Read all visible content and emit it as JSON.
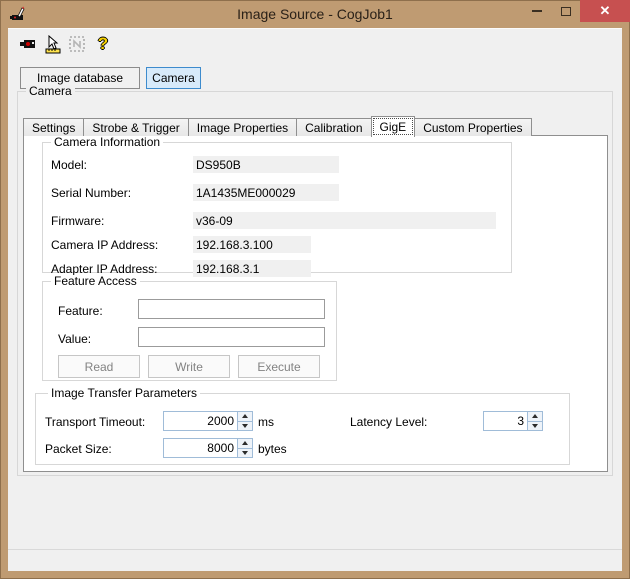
{
  "window": {
    "title": "Image Source - CogJob1",
    "close_glyph": "✕"
  },
  "colors": {
    "titlebar_tan": "#bf9b72",
    "close_red": "#c75050",
    "dialog_bg": "#f0f0f0",
    "page_bg": "#ffffff",
    "selected_button_bg": "#d7eafa",
    "selected_button_border": "#3d8bcd",
    "readonly_field_bg": "#f0f0f0"
  },
  "toolbar": {
    "help_glyph": "?"
  },
  "source_buttons": [
    {
      "label": "Image database",
      "selected": false
    },
    {
      "label": "Camera",
      "selected": true
    }
  ],
  "camera_group_label": "Camera",
  "tabs": [
    {
      "label": "Settings",
      "selected": false
    },
    {
      "label": "Strobe & Trigger",
      "selected": false
    },
    {
      "label": "Image Properties",
      "selected": false
    },
    {
      "label": "Calibration",
      "selected": false
    },
    {
      "label": "GigE",
      "selected": true
    },
    {
      "label": "Custom Properties",
      "selected": false
    }
  ],
  "camera_information": {
    "label": "Camera Information",
    "fields": [
      {
        "label": "Model:",
        "value": "DS950B"
      },
      {
        "label": "Serial Number:",
        "value": "1A1435ME000029"
      },
      {
        "label": "Firmware:",
        "value": "v36-09"
      },
      {
        "label": "Camera IP Address:",
        "value": "192.168.3.100"
      },
      {
        "label": "Adapter IP Address:",
        "value": "192.168.3.1"
      }
    ]
  },
  "feature_access": {
    "label": "Feature Access",
    "feature_label": "Feature:",
    "feature_value": "",
    "value_label": "Value:",
    "value_value": "",
    "buttons": [
      {
        "label": "Read",
        "enabled": false
      },
      {
        "label": "Write",
        "enabled": false
      },
      {
        "label": "Execute",
        "enabled": false
      }
    ]
  },
  "image_transfer": {
    "label": "Image Transfer Parameters",
    "transport_timeout": {
      "label": "Transport Timeout:",
      "value": "2000",
      "unit": "ms"
    },
    "packet_size": {
      "label": "Packet Size:",
      "value": "8000",
      "unit": "bytes"
    },
    "latency_level": {
      "label": "Latency Level:",
      "value": "3"
    }
  }
}
